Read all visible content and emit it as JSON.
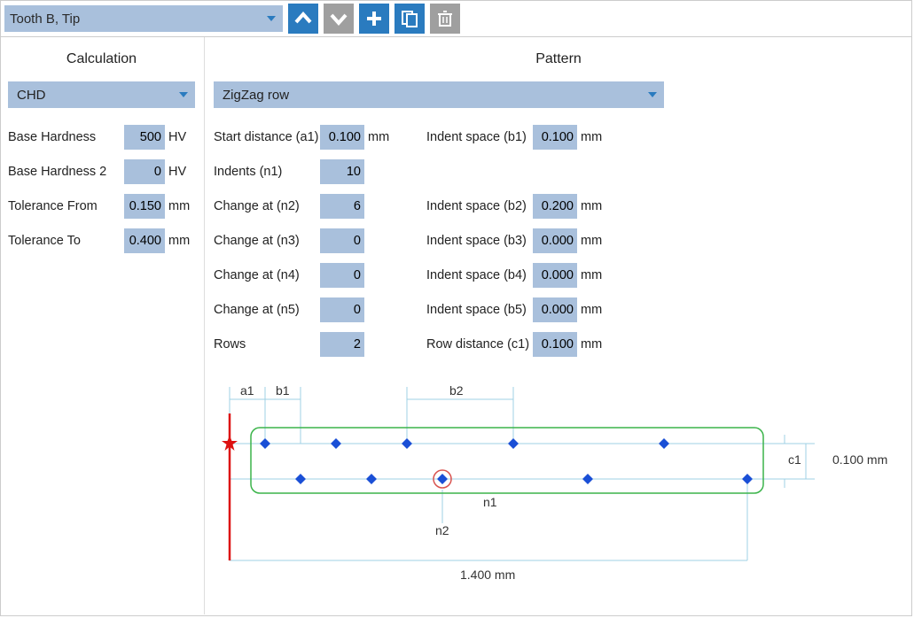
{
  "title": "Tooth B, Tip",
  "calc": {
    "title": "Calculation",
    "method": "CHD",
    "base_hardness_label": "Base Hardness",
    "base_hardness_value": "500",
    "base_hardness_unit": "HV",
    "base_hardness2_label": "Base Hardness 2",
    "base_hardness2_value": "0",
    "base_hardness2_unit": "HV",
    "tol_from_label": "Tolerance From",
    "tol_from_value": "0.150",
    "tol_from_unit": "mm",
    "tol_to_label": "Tolerance To",
    "tol_to_value": "0.400",
    "tol_to_unit": "mm"
  },
  "pattern": {
    "title": "Pattern",
    "type": "ZigZag row",
    "left": [
      {
        "label": "Start distance (a1)",
        "value": "0.100",
        "unit": "mm"
      },
      {
        "label": "Indents (n1)",
        "value": "10",
        "unit": ""
      },
      {
        "label": "Change at (n2)",
        "value": "6",
        "unit": ""
      },
      {
        "label": "Change at (n3)",
        "value": "0",
        "unit": ""
      },
      {
        "label": "Change at (n4)",
        "value": "0",
        "unit": ""
      },
      {
        "label": "Change at (n5)",
        "value": "0",
        "unit": ""
      },
      {
        "label": "Rows",
        "value": "2",
        "unit": ""
      }
    ],
    "right": [
      {
        "label": "Indent space (b1)",
        "value": "0.100",
        "unit": "mm"
      },
      {
        "label": "",
        "value": "",
        "unit": ""
      },
      {
        "label": "Indent space (b2)",
        "value": "0.200",
        "unit": "mm"
      },
      {
        "label": "Indent space (b3)",
        "value": "0.000",
        "unit": "mm"
      },
      {
        "label": "Indent space (b4)",
        "value": "0.000",
        "unit": "mm"
      },
      {
        "label": "Indent space (b5)",
        "value": "0.000",
        "unit": "mm"
      },
      {
        "label": "Row distance (c1)",
        "value": "0.100",
        "unit": "mm"
      }
    ]
  },
  "diagram": {
    "a1": "a1",
    "b1": "b1",
    "b2": "b2",
    "c1": "c1",
    "n1": "n1",
    "n2": "n2",
    "c1_val": "0.100 mm",
    "total": "1.400 mm"
  }
}
